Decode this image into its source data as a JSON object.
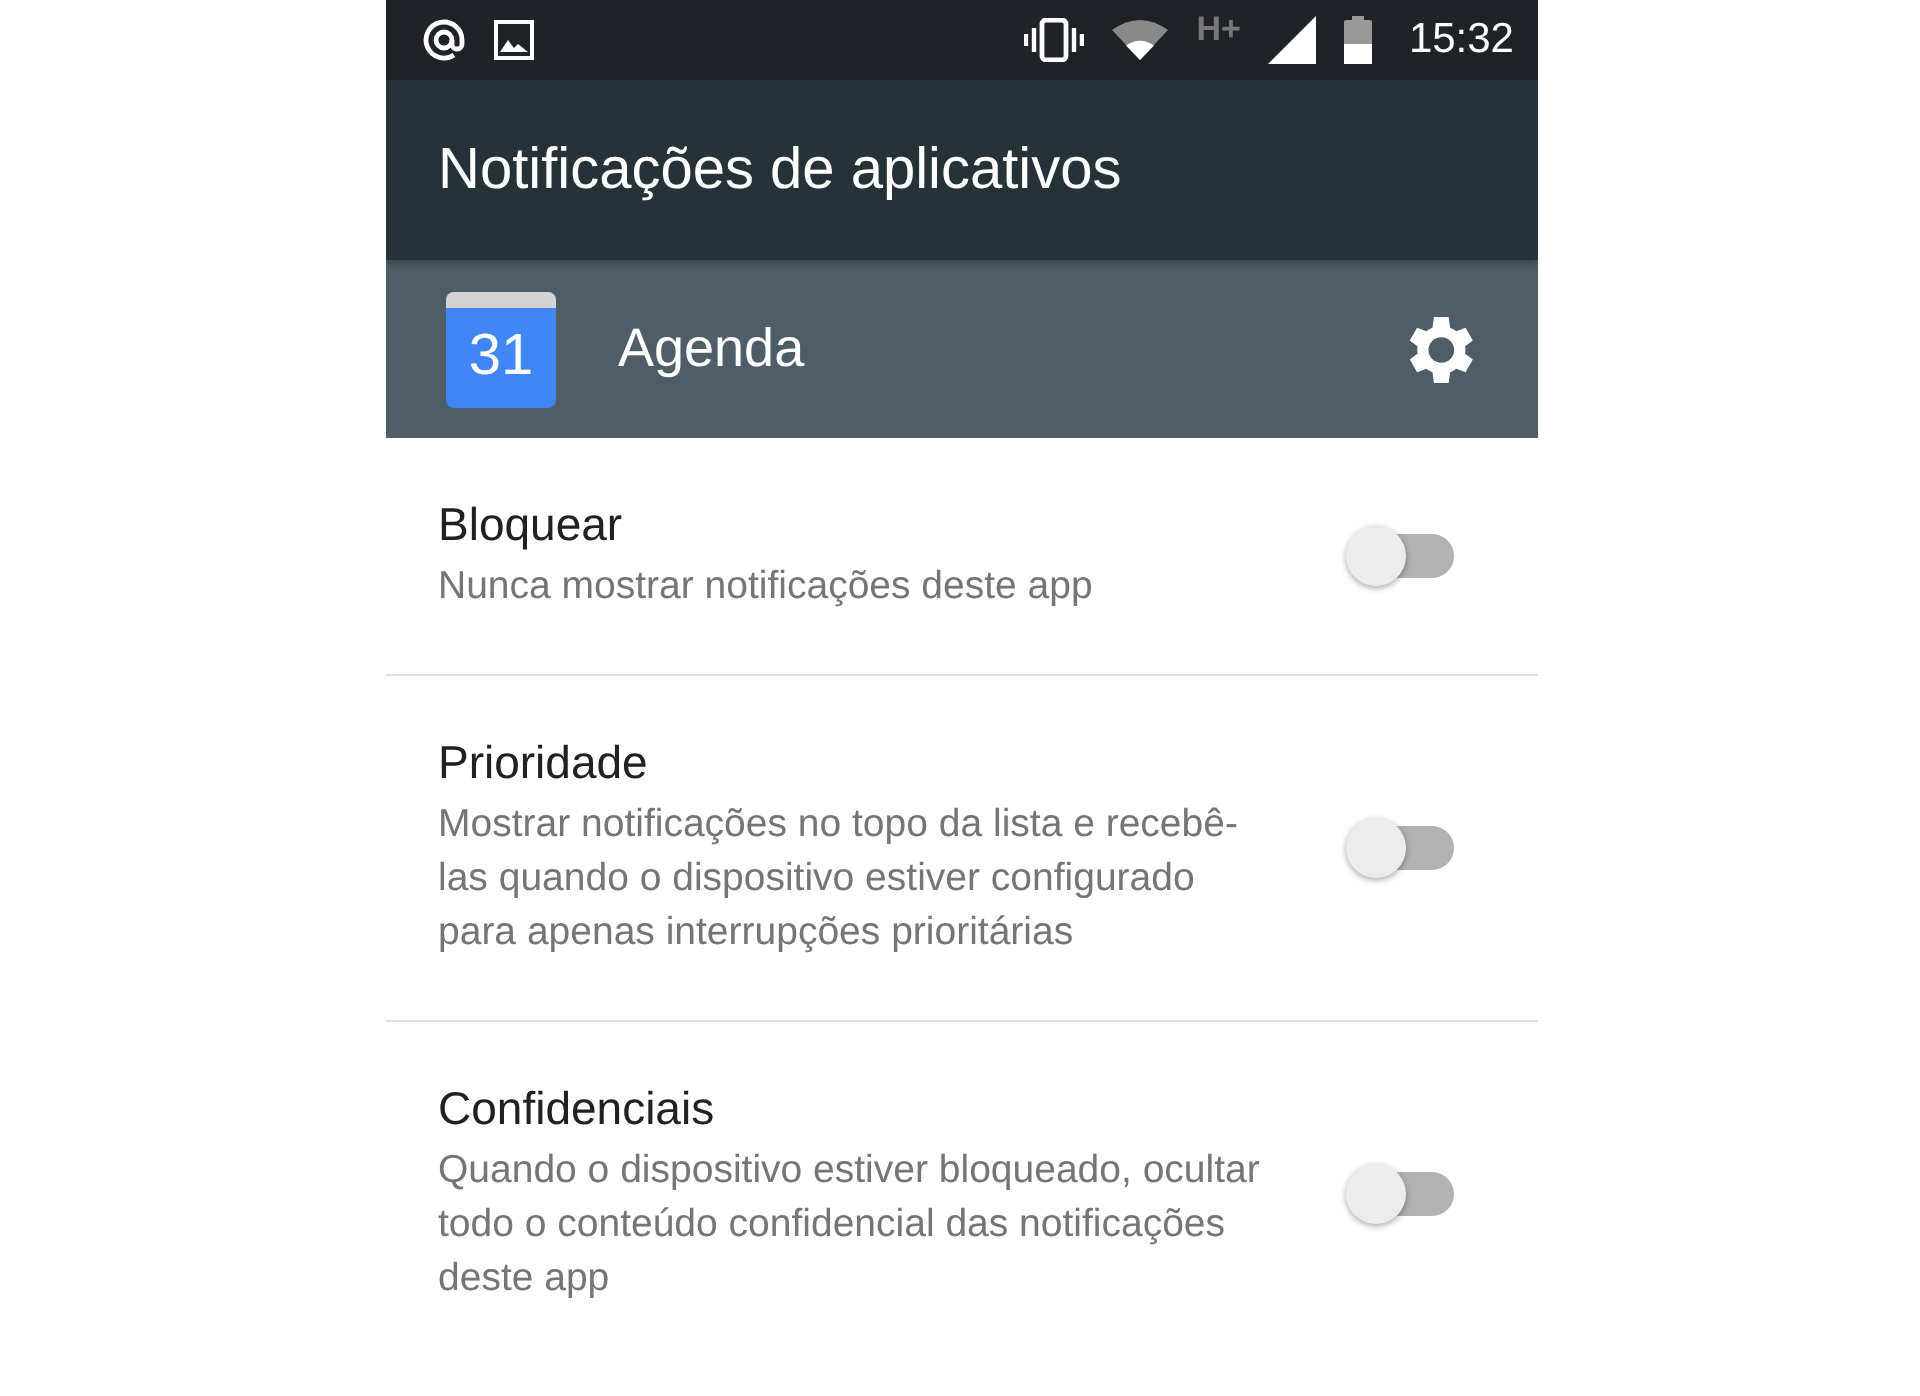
{
  "status_bar": {
    "network": "H+",
    "time": "15:32"
  },
  "header": {
    "title": "Notificações de aplicativos"
  },
  "app": {
    "icon_text": "31",
    "name": "Agenda"
  },
  "settings": [
    {
      "title": "Bloquear",
      "description": "Nunca mostrar notificações deste app",
      "on": false
    },
    {
      "title": "Prioridade",
      "description": "Mostrar notificações no topo da lista e recebê-las quando o dispositivo estiver configurado para apenas interrupções prioritárias",
      "on": false
    },
    {
      "title": "Confidenciais",
      "description": "Quando o dispositivo estiver bloqueado, ocultar todo o conteúdo confidencial das notificações deste app",
      "on": false
    }
  ]
}
